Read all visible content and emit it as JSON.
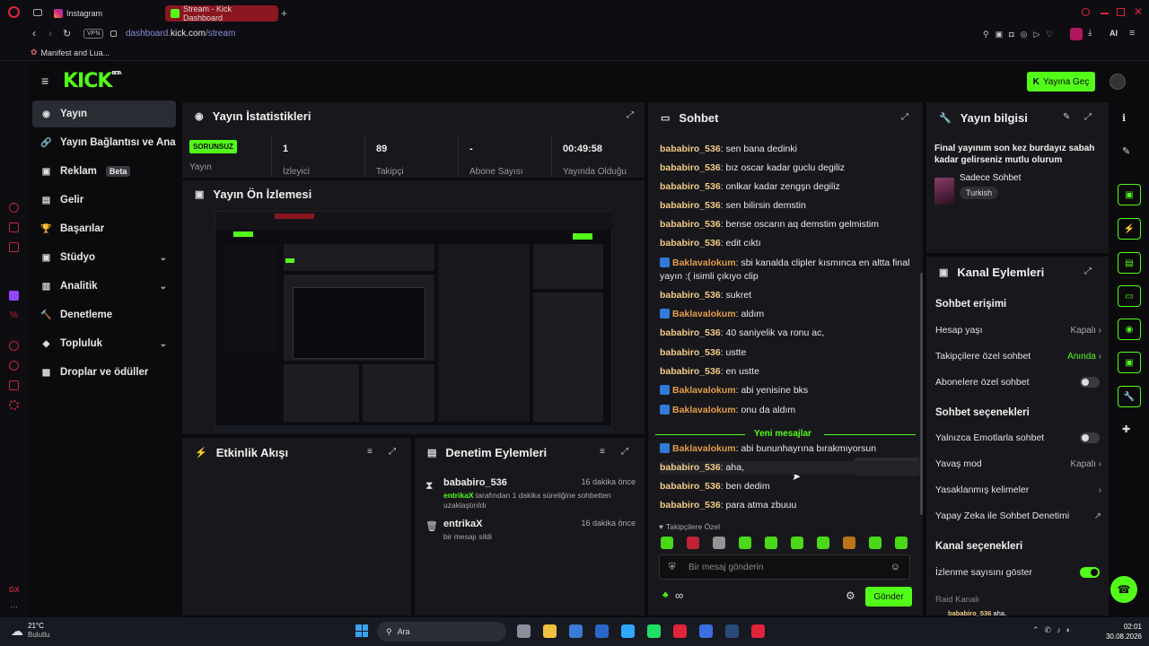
{
  "browser": {
    "tabs": [
      {
        "label": "Instagram"
      },
      {
        "label": "Stream - Kick Dashboard"
      }
    ],
    "new_tab": "+",
    "url_prefix": "dashboard.",
    "url_domain": "kick.com",
    "url_path": "/stream",
    "vpn": "VPN",
    "bookmark": "Manifest and Lua...",
    "ai_label": "AI"
  },
  "kick": {
    "logo": "KICK",
    "logo_sup": "BETA",
    "go_live": "Yayına Geç"
  },
  "sidebar": {
    "items": [
      {
        "label": "Yayın",
        "icon": "broadcast-icon"
      },
      {
        "label": "Yayın Bağlantısı ve Anahtarı",
        "icon": "link-icon"
      },
      {
        "label": "Reklam",
        "icon": "ad-icon",
        "badge": "Beta"
      },
      {
        "label": "Gelir",
        "icon": "revenue-icon"
      },
      {
        "label": "Başarılar",
        "icon": "trophy-icon"
      },
      {
        "label": "Stüdyo",
        "icon": "studio-icon"
      },
      {
        "label": "Analitik",
        "icon": "analytics-icon"
      },
      {
        "label": "Denetleme",
        "icon": "hammer-icon"
      },
      {
        "label": "Topluluk",
        "icon": "community-icon"
      },
      {
        "label": "Droplar ve ödüller",
        "icon": "gift-icon"
      }
    ]
  },
  "stats": {
    "title": "Yayın İstatistikleri",
    "status": "SORUNSUZ",
    "status_label": "Yayın",
    "viewers": "1",
    "viewers_label": "İzleyici",
    "followers": "89",
    "followers_label": "Takipçi",
    "subs": "-",
    "subs_label": "Abone Sayısı",
    "uptime": "00:49:58",
    "uptime_label": "Yayında Olduğu"
  },
  "preview": {
    "title": "Yayın Ön İzlemesi"
  },
  "activity": {
    "title": "Etkinlik Akışı"
  },
  "moderation": {
    "title": "Denetim Eylemleri",
    "items": [
      {
        "user": "bababiro_536",
        "time": "16 dakika önce",
        "actor": "entrikaX",
        "text": "tarafından 1 dakika süreliğine sohbetten uzaklaştırıldı"
      },
      {
        "user": "entrikaX",
        "time": "16 dakika önce",
        "text": "bir mesajı sildi"
      }
    ]
  },
  "chat": {
    "title": "Sohbet",
    "messages": [
      {
        "user": "bababiro_536",
        "text": "sen bana dedinki"
      },
      {
        "user": "bababiro_536",
        "text": "bız oscar kadar guclu degiliz"
      },
      {
        "user": "bababiro_536",
        "text": "onlkar kadar zengşn degiliz"
      },
      {
        "user": "bababiro_536",
        "text": "sen bilirsin demstin"
      },
      {
        "user": "bababiro_536",
        "text": "bense oscarın aq demstim gelmistim"
      },
      {
        "user": "bababiro_536",
        "text": "edit cıktı"
      },
      {
        "user": "Baklavalokum",
        "text": "sbi kanalda clipler kısmınca en altta final yayın :( isimli çıkıyo clip"
      },
      {
        "user": "bababiro_536",
        "text": "sukret"
      },
      {
        "user": "Baklavalokum",
        "text": "aldım"
      },
      {
        "user": "bababiro_536",
        "text": "40 saniyelik va ronu ac,"
      },
      {
        "user": "bababiro_536",
        "text": "ustte"
      },
      {
        "user": "bababiro_536",
        "text": "en ustte"
      },
      {
        "user": "Baklavalokum",
        "text": "abi yenisine bks"
      },
      {
        "user": "Baklavalokum",
        "text": "onu da aldım"
      },
      {
        "user": "Baklavalokum",
        "text": "abi bununhayrına bırakmıyorsun"
      },
      {
        "user": "bababiro_536",
        "text": "aha,"
      },
      {
        "user": "bababiro_536",
        "text": "ben dedim"
      },
      {
        "user": "bababiro_536",
        "text": "para atma zbuuu"
      }
    ],
    "new_messages": "Yeni mesajlar",
    "follower_only": "Takipçilere Özel",
    "input_placeholder": "Bir mesaj gönderin",
    "send": "Gönder"
  },
  "stream_info": {
    "title": "Yayın bilgisi",
    "stream_title": "Final yayınım son kez burdayız sabah kadar gelirseniz mutlu olurum",
    "category": "Sadece Sohbet",
    "language": "Turkish"
  },
  "channel_actions": {
    "title": "Kanal Eylemleri",
    "chat_access": "Sohbet erişimi",
    "account_age": "Hesap yaşı",
    "account_age_value": "Kapalı",
    "followers_chat": "Takipçilere özel sohbet",
    "followers_chat_value": "Anında",
    "subs_chat": "Abonelere özel sohbet",
    "chat_options": "Sohbet seçenekleri",
    "emotes_only": "Yalnızca Emotlarla sohbet",
    "slow_mode": "Yavaş mod",
    "slow_mode_value": "Kapalı",
    "banned_words": "Yasaklanmış kelimeler",
    "ai_moderation": "Yapay Zeka ile Sohbet Denetimi",
    "channel_options": "Kanal seçenekleri",
    "show_viewers": "İzlenme sayısını göster",
    "raid": "Raid Kanalı"
  },
  "taskbar": {
    "temp": "21°C",
    "weather": "Bulutlu",
    "search": "Ara",
    "time": "02:01",
    "date": "30.08.2026"
  },
  "colors": {
    "accent": "#53fc18",
    "panel": "#18181c",
    "bg": "#0b0b0e"
  }
}
